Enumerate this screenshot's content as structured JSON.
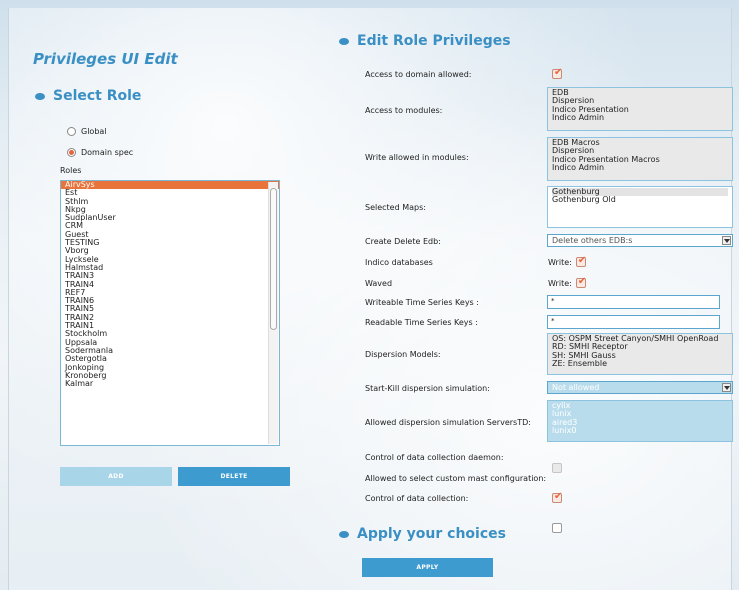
{
  "app_title": "Privileges UI Edit",
  "left": {
    "section_title": "Select Role",
    "radio_global": "Global",
    "radio_domain": "Domain spec",
    "roles_label": "Roles",
    "roles": [
      "AirvSys",
      "Est",
      "Sthlm",
      "Nkpg",
      "SudplanUser",
      "CRM",
      "Guest",
      "TESTING",
      "Vborg",
      "Lycksele",
      "Halmstad",
      "TRAIN3",
      "TRAIN4",
      "REF7",
      "TRAIN6",
      "TRAIN5",
      "TRAIN2",
      "TRAIN1",
      "Stockholm",
      "Uppsala",
      "Sodermanla",
      "Ostergotla",
      "Jonkoping",
      "Kronoberg",
      "Kalmar"
    ],
    "selected_role": "AirvSys",
    "add_label": "ADD",
    "delete_label": "DELETE"
  },
  "right": {
    "section_title": "Edit Role Privileges",
    "access_domain_label": "Access to domain allowed:",
    "access_modules_label": "Access to modules:",
    "access_modules": [
      "EDB",
      "Dispersion",
      "Indico Presentation",
      "Indico Admin"
    ],
    "write_modules_label": "Write allowed in modules:",
    "write_modules": [
      "EDB Macros",
      "Dispersion",
      "Indico Presentation Macros",
      "Indico Admin"
    ],
    "selected_maps_label": "Selected Maps:",
    "selected_maps": [
      "Gothenburg",
      "Gothenburg Old"
    ],
    "create_delete_label": "Create Delete Edb:",
    "create_delete_value": "Delete others EDB:s",
    "indico_db_label": "Indico databases",
    "waved_label": "Waved",
    "write_label": "Write:",
    "writeable_ts_label": "Writeable Time Series Keys :",
    "writeable_ts_value": "*",
    "readable_ts_label": "Readable Time Series Keys :",
    "readable_ts_value": "*",
    "dispersion_models_label": "Dispersion Models:",
    "dispersion_models": [
      "OS: OSPM Street Canyon/SMHI OpenRoad",
      "RD: SMHI Receptor",
      "SH: SMHI Gauss",
      "ZE: Ensemble"
    ],
    "start_kill_label": "Start-Kill dispersion simulation:",
    "start_kill_value": "Not allowed",
    "servers_label": "Allowed dispersion simulation ServersTD:",
    "servers": [
      "cylix",
      "lunix",
      "aired3",
      "lunix0"
    ],
    "ctrl_daemon_label": "Control of data collection daemon:",
    "custom_mast_label": "Allowed to select custom mast configuration:",
    "ctrl_collection_label": "Control of data collection:",
    "apply_title": "Apply your choices",
    "apply_label": "APPLY"
  }
}
